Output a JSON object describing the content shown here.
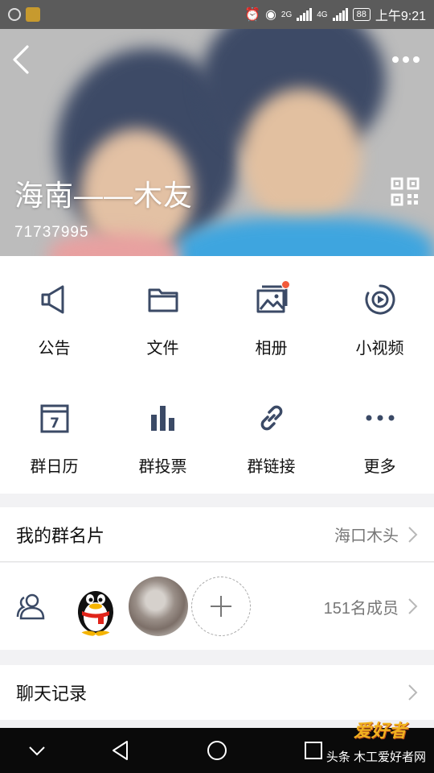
{
  "status_bar": {
    "network_1": "2G",
    "network_2": "4G",
    "battery": "88",
    "time": "上午9:21"
  },
  "header": {
    "group_name": "海南——木友",
    "group_id": "71737995",
    "icons": [
      "back-icon",
      "more-icon",
      "qr-code-icon"
    ]
  },
  "actions": [
    {
      "label": "公告",
      "icon": "megaphone-icon"
    },
    {
      "label": "文件",
      "icon": "folder-icon"
    },
    {
      "label": "相册",
      "icon": "album-icon"
    },
    {
      "label": "小视频",
      "icon": "video-icon"
    },
    {
      "label": "群日历",
      "icon": "calendar-icon"
    },
    {
      "label": "群投票",
      "icon": "vote-icon"
    },
    {
      "label": "群链接",
      "icon": "link-icon"
    },
    {
      "label": "更多",
      "icon": "more-dots-icon"
    }
  ],
  "calendar_day": "7",
  "card": {
    "title": "我的群名片",
    "value": "海口木头"
  },
  "members": {
    "count_label": "151名成员"
  },
  "history": {
    "title": "聊天记录"
  },
  "watermark": {
    "logo": "爱好者",
    "text": "头条 木工爱好者网"
  },
  "colors": {
    "accent_dot": "#f25a3a",
    "icon_blue": "#3b4a66",
    "nav_bg": "#0a0a0a"
  }
}
